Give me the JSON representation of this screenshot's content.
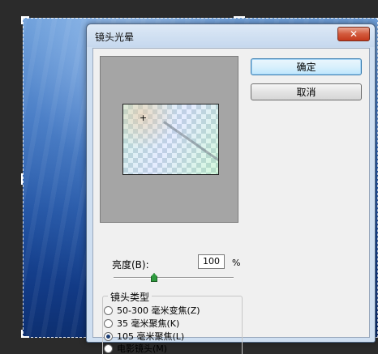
{
  "window": {
    "title": "镜头光晕",
    "close_glyph": "✕"
  },
  "buttons": {
    "ok_label": "确定",
    "cancel_label": "取消"
  },
  "brightness": {
    "label": "亮度(B):",
    "value": "100",
    "unit": "%",
    "slider_level": 100
  },
  "lens_type": {
    "legend": "镜头类型",
    "options": [
      {
        "label": "50-300 毫米变焦(Z)",
        "checked": false
      },
      {
        "label": "35 毫米聚焦(K)",
        "checked": false
      },
      {
        "label": "105 毫米聚焦(L)",
        "checked": true
      },
      {
        "label": "电影镜头(M)",
        "checked": false
      }
    ]
  },
  "preview": {
    "crosshair_glyph": "+"
  },
  "colors": {
    "titlebar": "#c6d8ee",
    "close_button": "#c4391c",
    "slider_thumb": "#2e9a3e",
    "canvas_blue": "#1e4fa0"
  },
  "icons": {
    "close": "close-icon",
    "crosshair": "crosshair-icon",
    "slider": "triangle-thumb-icon"
  }
}
